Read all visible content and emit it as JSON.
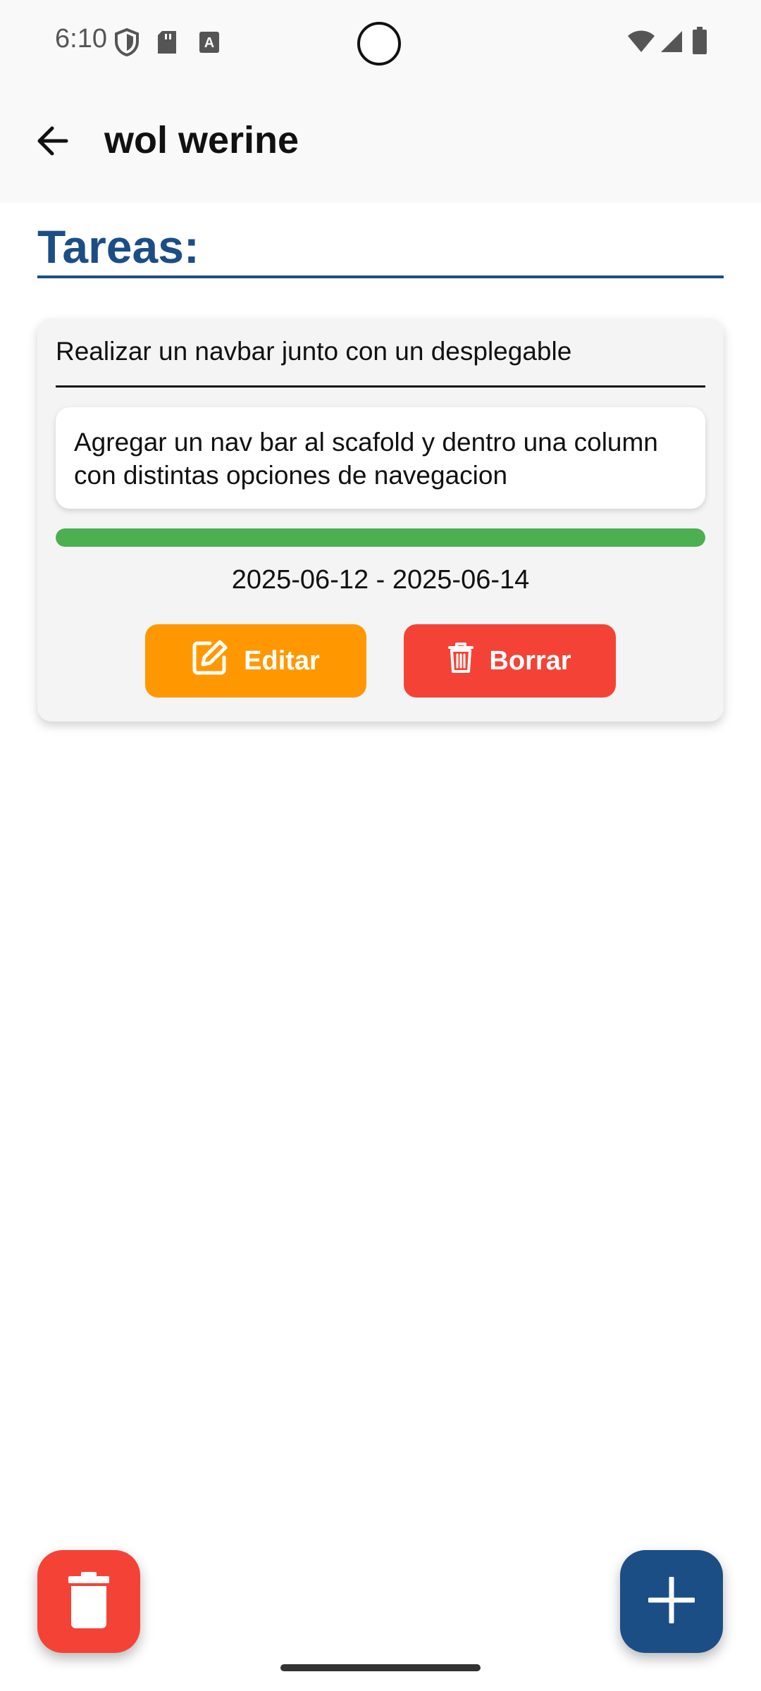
{
  "status_bar": {
    "time": "6:10",
    "icons": [
      "shield-icon",
      "sd-card-icon",
      "keyboard-a-icon",
      "wifi-icon",
      "signal-icon",
      "battery-icon"
    ]
  },
  "app_bar": {
    "back_icon": "arrow-left-icon",
    "title": "wol werine"
  },
  "section": {
    "title": "Tareas:",
    "accent_color": "#1c4e86"
  },
  "tasks": [
    {
      "title": "Realizar un navbar junto con un desplegable",
      "description": "Agregar un nav bar al scafold y dentro una column con distintas opciones de navegacion",
      "progress": 1.0,
      "progress_color": "#4caf50",
      "date_range": "2025-06-12 - 2025-06-14",
      "edit_label": "Editar",
      "edit_icon": "edit-icon",
      "edit_color": "#ff9800",
      "delete_label": "Borrar",
      "delete_icon": "trash-icon",
      "delete_color": "#f44336"
    }
  ],
  "fabs": {
    "delete_all_icon": "trash-icon",
    "delete_all_color": "#f44336",
    "add_icon": "plus-icon",
    "add_color": "#1c4e86"
  }
}
